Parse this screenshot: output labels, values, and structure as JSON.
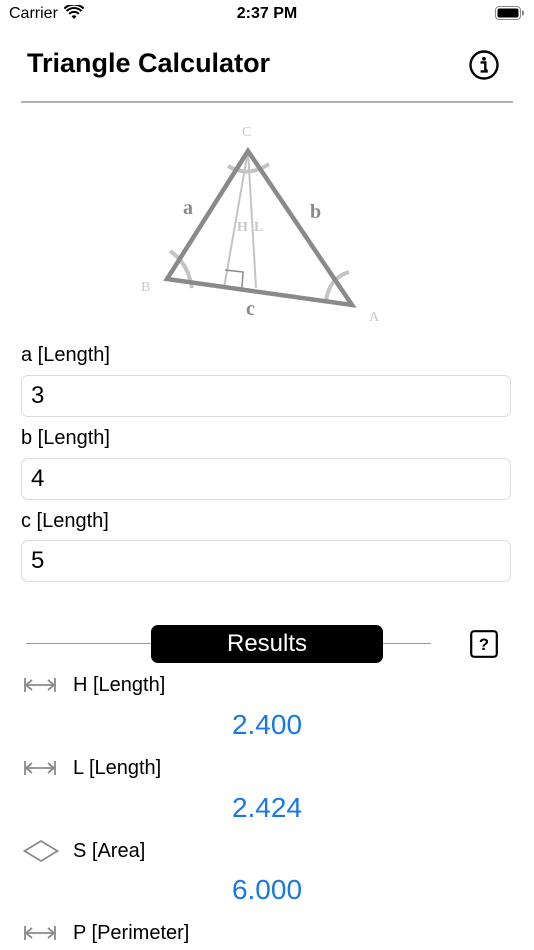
{
  "status_bar": {
    "carrier": "Carrier",
    "time": "2:37 PM"
  },
  "header": {
    "title": "Triangle Calculator"
  },
  "diagram": {
    "vertex_c": "C",
    "vertex_b": "B",
    "vertex_a": "A",
    "side_a": "a",
    "side_b": "b",
    "side_c": "c",
    "h_label": "H",
    "l_label": "L"
  },
  "inputs": [
    {
      "label": "a [Length]",
      "value": "3"
    },
    {
      "label": "b [Length]",
      "value": "4"
    },
    {
      "label": "c [Length]",
      "value": "5"
    }
  ],
  "results": {
    "title": "Results",
    "items": [
      {
        "icon": "arrow-width-icon",
        "label": "H [Length]",
        "value": "2.400"
      },
      {
        "icon": "arrow-width-icon",
        "label": "L [Length]",
        "value": "2.424"
      },
      {
        "icon": "diamond-area-icon",
        "label": "S [Area]",
        "value": "6.000"
      },
      {
        "icon": "arrow-width-icon",
        "label": "P [Perimeter]",
        "value": ""
      }
    ]
  },
  "colors": {
    "accent": "#1878e8",
    "pill": "#000000",
    "divider": "#b0b0b0"
  }
}
